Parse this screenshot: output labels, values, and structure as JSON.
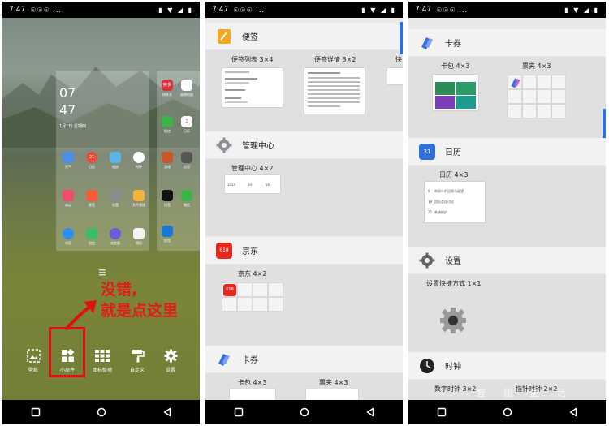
{
  "status": {
    "time": "7:47",
    "left_icons": "☉☉☉ ...",
    "right_icons": "▮ ▼ ◢ ▮"
  },
  "panel1": {
    "clock": {
      "hour": "07",
      "minute": "47",
      "date": "1月1日 星期四"
    },
    "apps_right": [
      {
        "label": "拼多多",
        "color": "#d8323d",
        "icon_text": "拼多"
      },
      {
        "label": "高德地图",
        "color": "#ffffff",
        "icon_text": ""
      },
      {
        "label": "微信",
        "color": "#3bb54a",
        "icon_text": ""
      },
      {
        "label": "日历",
        "color": "#ffffff",
        "icon_text": "1"
      },
      {
        "label": "游戏",
        "color": "#c9572a",
        "icon_text": ""
      },
      {
        "label": "应用",
        "color": "#555555",
        "icon_text": ""
      },
      {
        "label": "抖音",
        "color": "#111111",
        "icon_text": ""
      },
      {
        "label": "微信",
        "color": "#3bb54a",
        "icon_text": ""
      },
      {
        "label": "应用",
        "color": "#1a79d6",
        "icon_text": ""
      }
    ],
    "apps_main": [
      {
        "label": "天气",
        "color": "#4a8fe8"
      },
      {
        "label": "日历",
        "color": "#e74c3c",
        "icon_text": "21"
      },
      {
        "label": "相册",
        "color": "#58b7e8"
      },
      {
        "label": "时钟",
        "color": "#ffffff"
      },
      {
        "label": "商店",
        "color": "#ef4d6d"
      },
      {
        "label": "便签",
        "color": "#f25d3c"
      },
      {
        "label": "设置",
        "color": "#8d8d8d"
      },
      {
        "label": "文件管理",
        "color": "#f4b33b"
      },
      {
        "label": "电话",
        "color": "#2e8df0"
      },
      {
        "label": "短信",
        "color": "#3fbb62"
      },
      {
        "label": "浏览器",
        "color": "#6a5bd8"
      },
      {
        "label": "相机",
        "color": "#f2f2f2"
      }
    ],
    "dock": [
      {
        "label": "壁纸"
      },
      {
        "label": "小部件"
      },
      {
        "label": "图标整理"
      },
      {
        "label": "自定义"
      },
      {
        "label": "设置"
      }
    ],
    "annotation": {
      "line1": "没错,",
      "line2": "就是点这里"
    }
  },
  "panel2": {
    "sections": [
      {
        "title": "便签",
        "icon_color": "#f5a623",
        "widgets": [
          {
            "label": "便签列表 3×4"
          },
          {
            "label": "便签详情 3×2"
          },
          {
            "label": "快"
          }
        ]
      },
      {
        "title": "管理中心",
        "icon_color": "#8a8f99",
        "widgets": [
          {
            "label": "管理中心 4×2"
          }
        ],
        "stats": [
          "1024",
          "50",
          "56"
        ]
      },
      {
        "title": "京东",
        "icon_color": "#e4281d",
        "badge": "618",
        "widgets": [
          {
            "label": "京东 4×2"
          }
        ]
      },
      {
        "title": "卡券",
        "icon_color": "#3a6fe0",
        "widgets": [
          {
            "label": "卡包 4×3"
          },
          {
            "label": "票夹 4×3"
          }
        ]
      }
    ]
  },
  "panel3": {
    "sections": [
      {
        "title": "卡券",
        "icon_color": "#3a6fe0",
        "widgets": [
          {
            "label": "卡包 4×3"
          },
          {
            "label": "票夹 4×3"
          }
        ]
      },
      {
        "title": "日历",
        "icon_color": "#2f6fdc",
        "icon_text": "31",
        "widgets": [
          {
            "label": "日历 4×3"
          }
        ],
        "events": [
          {
            "day": "8",
            "text": "每周年的回顾与展望"
          },
          {
            "day": "19",
            "text": "团队会议讨论"
          },
          {
            "day": "25",
            "text": "系统维护"
          }
        ]
      },
      {
        "title": "设置",
        "icon_color": "#666666",
        "widgets": [
          {
            "label": "设置快捷方式 1×1"
          }
        ]
      },
      {
        "title": "时钟",
        "icon_color": "#222222",
        "widgets": [
          {
            "label": "数字时钟 3×2"
          },
          {
            "label": "指针时钟 2×2"
          }
        ]
      }
    ],
    "watermark": "智能生活"
  },
  "colors": {
    "accent": "#2f6fdc",
    "annotation_red": "#e51a1a"
  }
}
